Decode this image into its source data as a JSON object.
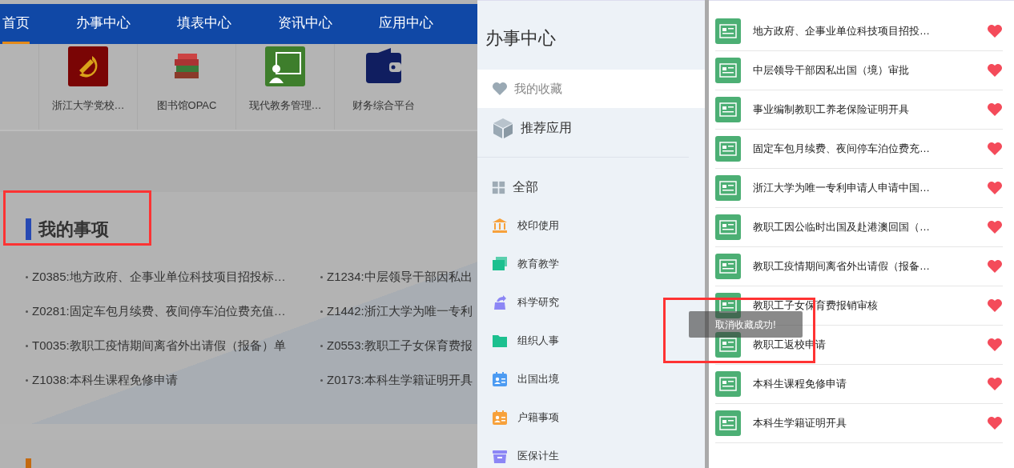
{
  "nav": {
    "items": [
      {
        "label": "首页",
        "selected": true
      },
      {
        "label": "办事中心",
        "selected": false
      },
      {
        "label": "填表中心",
        "selected": false
      },
      {
        "label": "资讯中心",
        "selected": false
      },
      {
        "label": "应用中心",
        "selected": false
      }
    ]
  },
  "apps": [
    {
      "label": "浙江大学党校…",
      "kind": "party"
    },
    {
      "label": "图书馆OPAC",
      "kind": "books"
    },
    {
      "label": "现代教务管理…",
      "kind": "teaching"
    },
    {
      "label": "财务综合平台",
      "kind": "wallet"
    }
  ],
  "my_items": {
    "title": "我的事项",
    "items": [
      "Z0385:地方政府、企事业单位科技项目招投标…",
      "Z1234:中层领导干部因私出",
      "Z0281:固定车包月续费、夜间停车泊位费充值…",
      "Z1442:浙江大学为唯一专利",
      "T0035:教职工疫情期间离省外出请假（报备）单",
      "Z0553:教职工子女保育费报",
      "Z1038:本科生课程免修申请",
      "Z0173:本科生学籍证明开具"
    ]
  },
  "drawer": {
    "title": "办事中心",
    "tabs": [
      {
        "label": "我的收藏",
        "kind": "heart",
        "selected": true
      },
      {
        "label": "推荐应用",
        "kind": "cube",
        "selected": false
      }
    ],
    "categories": [
      {
        "label": "全部",
        "kind": "grid",
        "color": "#9eabb5"
      },
      {
        "label": "校印使用",
        "kind": "bank",
        "color": "#f7a13b"
      },
      {
        "label": "教育教学",
        "kind": "stack",
        "color": "#1cc08f"
      },
      {
        "label": "科学研究",
        "kind": "flask",
        "color": "#8c86f5"
      },
      {
        "label": "组织人事",
        "kind": "folder",
        "color": "#1cc08f"
      },
      {
        "label": "出国出境",
        "kind": "card",
        "color": "#4c9bf2"
      },
      {
        "label": "户籍事项",
        "kind": "card",
        "color": "#f7a13b"
      },
      {
        "label": "医保计生",
        "kind": "box",
        "color": "#8c86f5"
      }
    ]
  },
  "favorites": [
    {
      "label": "地方政府、企事业单位科技项目招投…",
      "favorited": true
    },
    {
      "label": "中层领导干部因私出国（境）审批",
      "favorited": true
    },
    {
      "label": "事业编制教职工养老保险证明开具",
      "favorited": true
    },
    {
      "label": "固定车包月续费、夜间停车泊位费充…",
      "favorited": true
    },
    {
      "label": "浙江大学为唯一专利申请人申请中国…",
      "favorited": true
    },
    {
      "label": "教职工因公临时出国及赴港澳回国（…",
      "favorited": true
    },
    {
      "label": "教职工疫情期间离省外出请假（报备…",
      "favorited": true
    },
    {
      "label": "教职工子女保育费报销审核",
      "favorited": true
    },
    {
      "label": "教职工返校申请",
      "favorited": true
    },
    {
      "label": "本科生课程免修申请",
      "favorited": true
    },
    {
      "label": "本科生学籍证明开具",
      "favorited": true
    }
  ],
  "toast": {
    "text": "取消收藏成功!"
  }
}
